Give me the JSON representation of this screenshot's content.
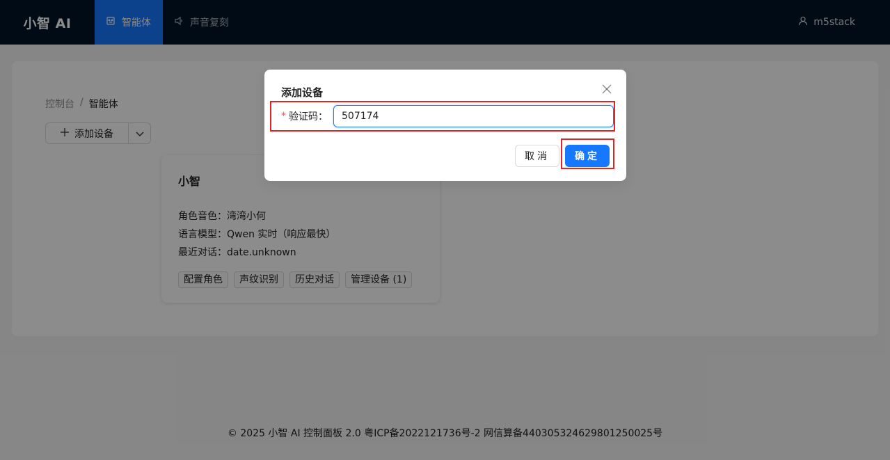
{
  "header": {
    "logo": "小智 AI",
    "nav": [
      {
        "label": "智能体",
        "icon": "robot-icon",
        "active": true
      },
      {
        "label": "声音复刻",
        "icon": "sound-icon",
        "active": false
      }
    ],
    "user": {
      "name": "m5stack",
      "icon": "user-icon"
    }
  },
  "breadcrumb": {
    "root": "控制台",
    "separator": "/",
    "current": "智能体"
  },
  "toolbar": {
    "add_device_label": "添加设备",
    "plus_icon": "plus-icon",
    "dropdown_icon": "chevron-down-icon"
  },
  "agent_card": {
    "title": "小智",
    "voice": "角色音色：湾湾小何",
    "model": "语言模型：Qwen 实时（响应最快）",
    "last_chat": "最近对话：date.unknown",
    "tags": [
      "配置角色",
      "声纹识别",
      "历史对话",
      "管理设备 (1)"
    ]
  },
  "footer": "© 2025 小智 AI 控制面板 2.0 粤ICP备2022121736号-2 网信算备440305324629801250025号",
  "modal": {
    "title": "添加设备",
    "field_label": "验证码",
    "field_required_mark": "*",
    "field_colon": "：",
    "field_value": "507174",
    "cancel_label": "取消",
    "ok_label": "确定",
    "close_icon": "close-icon"
  },
  "colors": {
    "header_bg": "#001529",
    "primary": "#1677ff",
    "highlight": "#e02424"
  }
}
